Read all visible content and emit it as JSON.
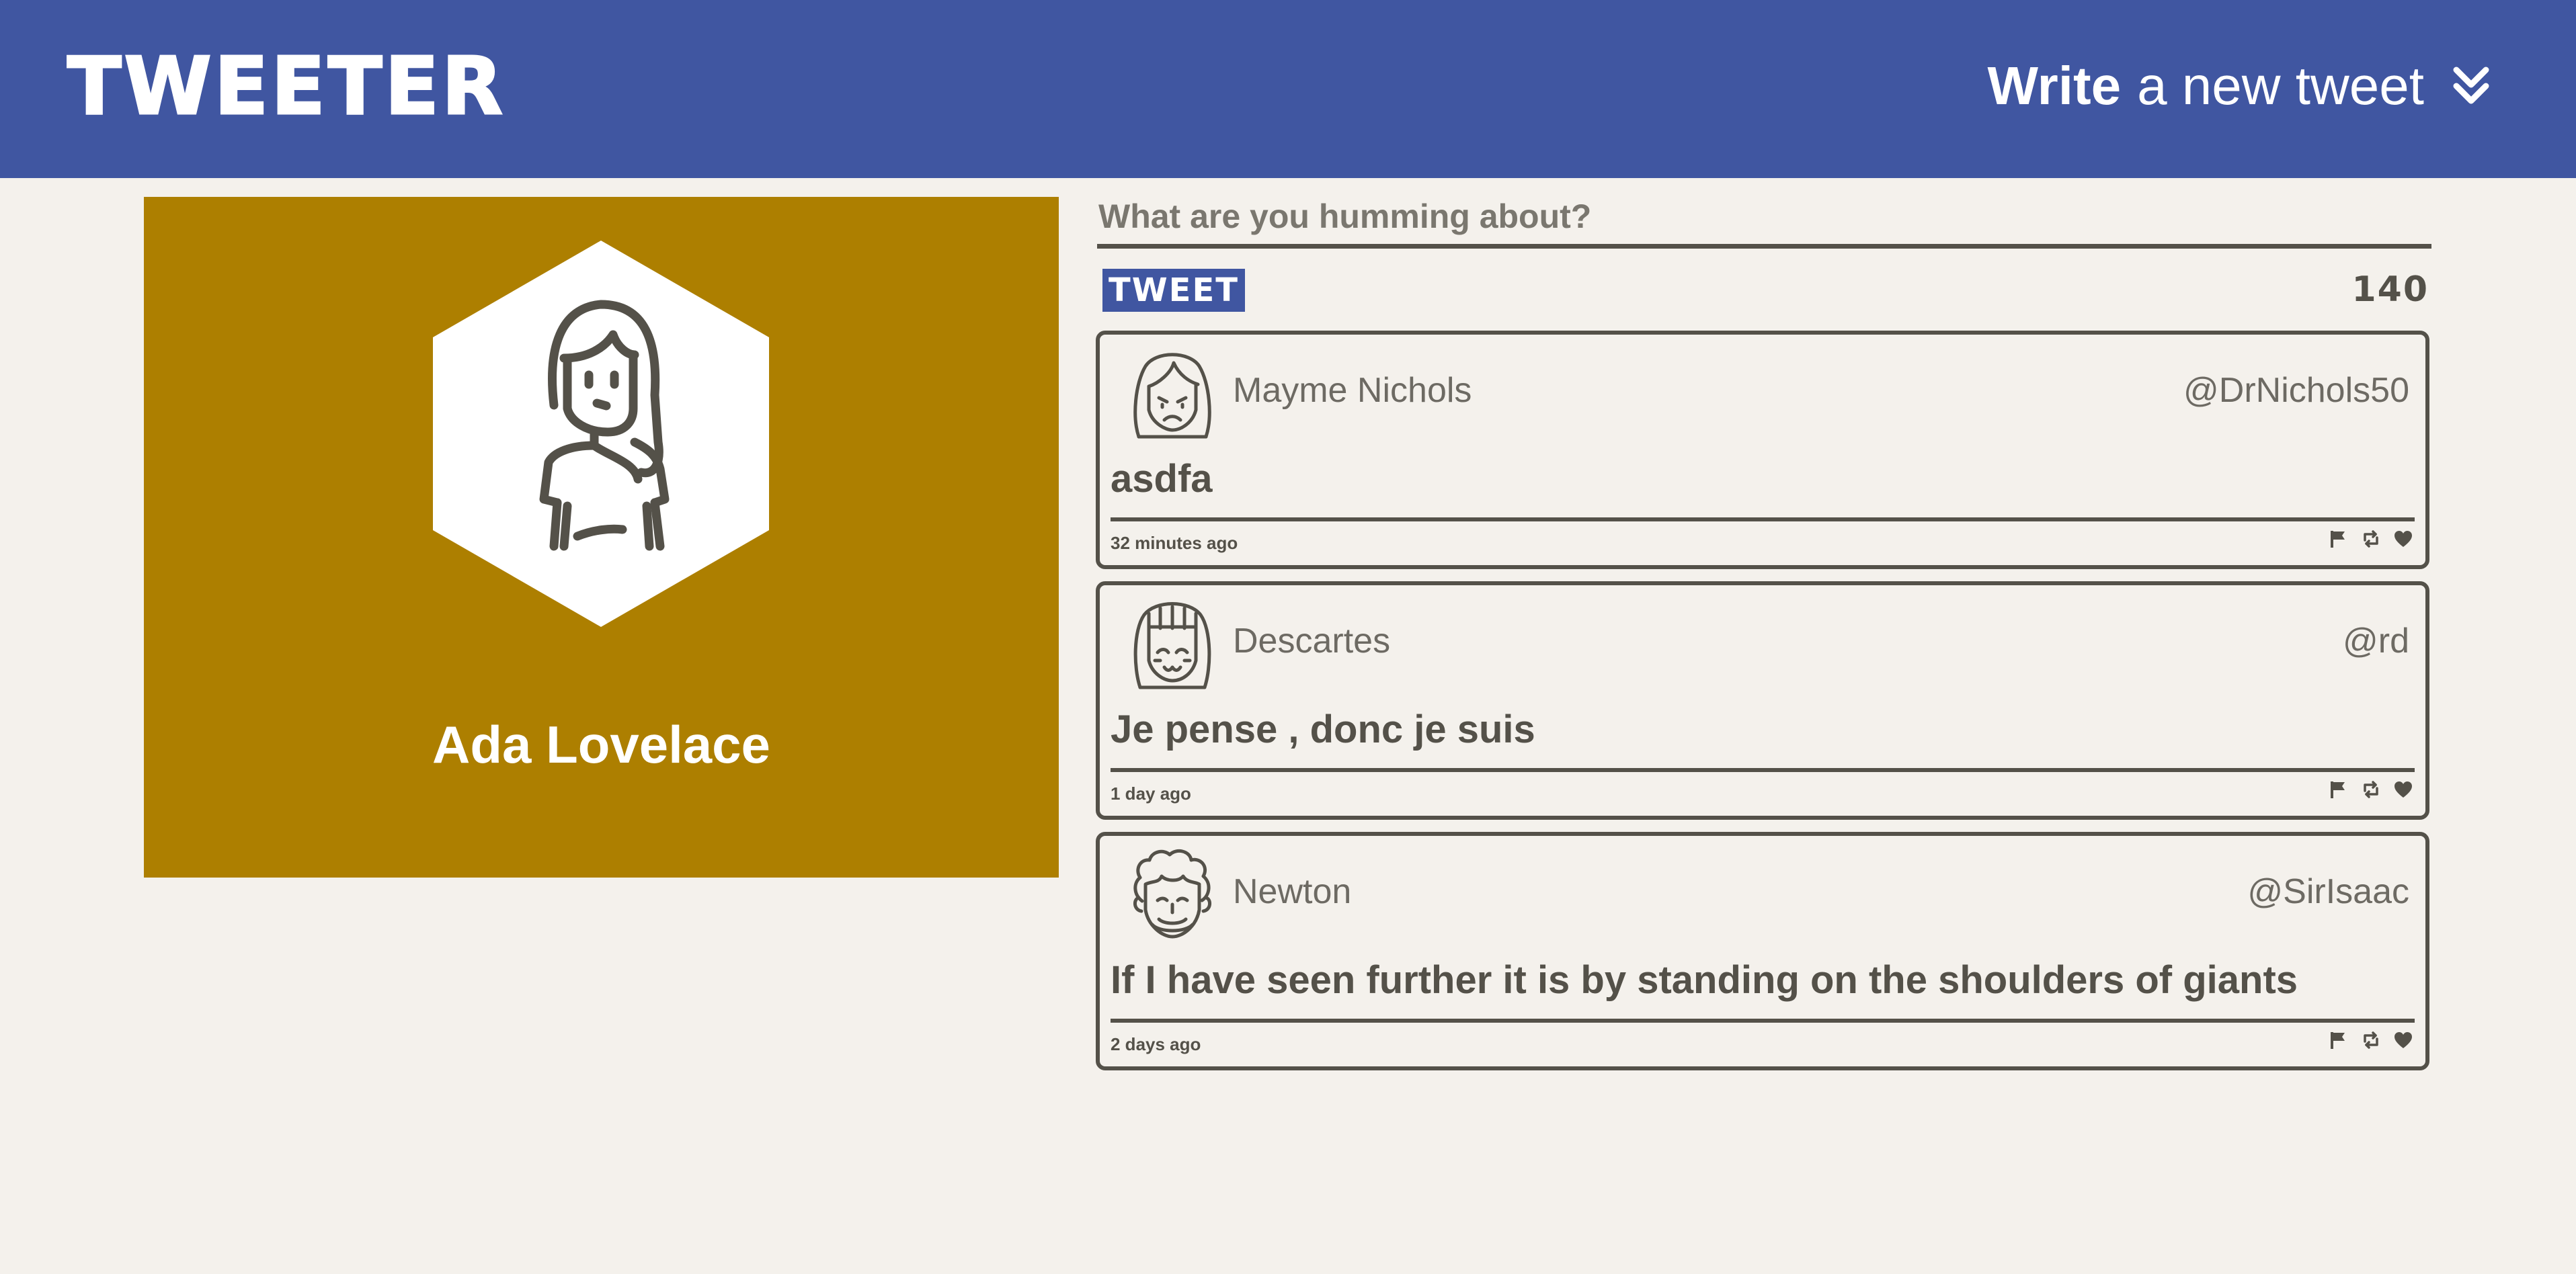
{
  "header": {
    "logo": "TWEETER",
    "compose_toggle": {
      "bold": "Write",
      "rest": "a new tweet",
      "icon": "double-chevron-down-icon"
    }
  },
  "profile": {
    "name": "Ada Lovelace",
    "avatar_icon": "woman-avatar-icon",
    "background_color": "#ad7f00"
  },
  "compose": {
    "placeholder": "What are you humming about?",
    "value": "",
    "submit_label": "TWEET",
    "char_count": "140"
  },
  "tweets": [
    {
      "name": "Mayme Nichols",
      "handle": "@DrNichols50",
      "content": "asdfa",
      "time": "32 minutes ago",
      "avatar_icon": "sad-woman-avatar-icon"
    },
    {
      "name": "Descartes",
      "handle": "@rd",
      "content": "Je pense , donc je suis",
      "time": "1 day ago",
      "avatar_icon": "smiling-bangs-avatar-icon"
    },
    {
      "name": "Newton",
      "handle": "@SirIsaac",
      "content": "If I have seen further it is by standing on the shoulders of giants",
      "time": "2 days ago",
      "avatar_icon": "curly-hair-avatar-icon"
    }
  ],
  "tweet_actions": [
    "flag-icon",
    "retweet-icon",
    "heart-icon"
  ],
  "colors": {
    "header": "#4056a1",
    "background": "#f4f1ec",
    "text": "#545149",
    "profile": "#ad7f00"
  }
}
